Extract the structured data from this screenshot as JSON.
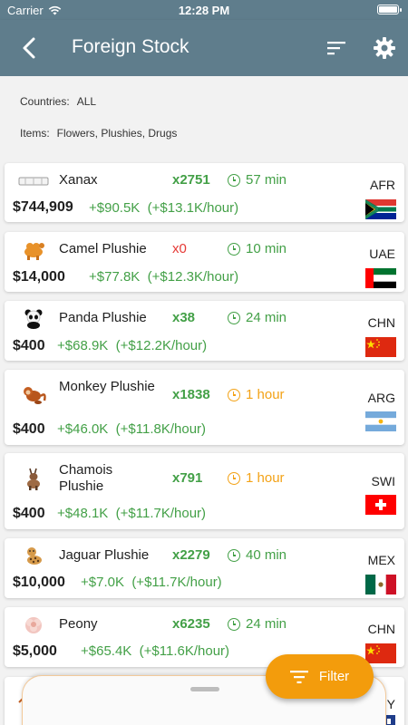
{
  "status_bar": {
    "carrier": "Carrier",
    "time": "12:28 PM"
  },
  "app_bar": {
    "title": "Foreign Stock"
  },
  "filters": {
    "countries_label": "Countries:",
    "countries_value": "ALL",
    "items_label": "Items:",
    "items_value": "Flowers, Plushies, Drugs"
  },
  "items": [
    {
      "name": "Xanax",
      "qty": "x2751",
      "time": "57 min",
      "time_status": "green",
      "price": "$744,909",
      "profit": "+$90.5K",
      "rate": "(+$13.1K/hour)",
      "country": "AFR",
      "icon": "pill-icon"
    },
    {
      "name": "Camel Plushie",
      "qty": "x0",
      "time": "10 min",
      "time_status": "green",
      "price": "$14,000",
      "profit": "+$77.8K",
      "rate": "(+$12.3K/hour)",
      "country": "UAE",
      "icon": "camel-plushie-icon"
    },
    {
      "name": "Panda Plushie",
      "qty": "x38",
      "time": "24 min",
      "time_status": "green",
      "price": "$400",
      "profit": "+$68.9K",
      "rate": "(+$12.2K/hour)",
      "country": "CHN",
      "icon": "panda-plushie-icon"
    },
    {
      "name": "Monkey Plushie",
      "qty": "x1838",
      "time": "1 hour",
      "time_status": "orange",
      "price": "$400",
      "profit": "+$46.0K",
      "rate": "(+$11.8K/hour)",
      "country": "ARG",
      "icon": "monkey-plushie-icon"
    },
    {
      "name": "Chamois Plushie",
      "qty": "x791",
      "time": "1 hour",
      "time_status": "orange",
      "price": "$400",
      "profit": "+$48.1K",
      "rate": "(+$11.7K/hour)",
      "country": "SWI",
      "icon": "chamois-plushie-icon"
    },
    {
      "name": "Jaguar Plushie",
      "qty": "x2279",
      "time": "40 min",
      "time_status": "green",
      "price": "$10,000",
      "profit": "+$7.0K",
      "rate": "(+$11.7K/hour)",
      "country": "MEX",
      "icon": "jaguar-plushie-icon"
    },
    {
      "name": "Peony",
      "qty": "x6235",
      "time": "24 min",
      "time_status": "green",
      "price": "$5,000",
      "profit": "+$65.4K",
      "rate": "(+$11.6K/hour)",
      "country": "CHN",
      "icon": "peony-icon"
    }
  ],
  "partial_item": {
    "country": "Y"
  },
  "fab": {
    "label": "Filter"
  },
  "colors": {
    "app_bar": "#5f7d8c",
    "green": "#43a047",
    "red": "#e53935",
    "orange": "#f3a216",
    "fab": "#f39c0c"
  }
}
